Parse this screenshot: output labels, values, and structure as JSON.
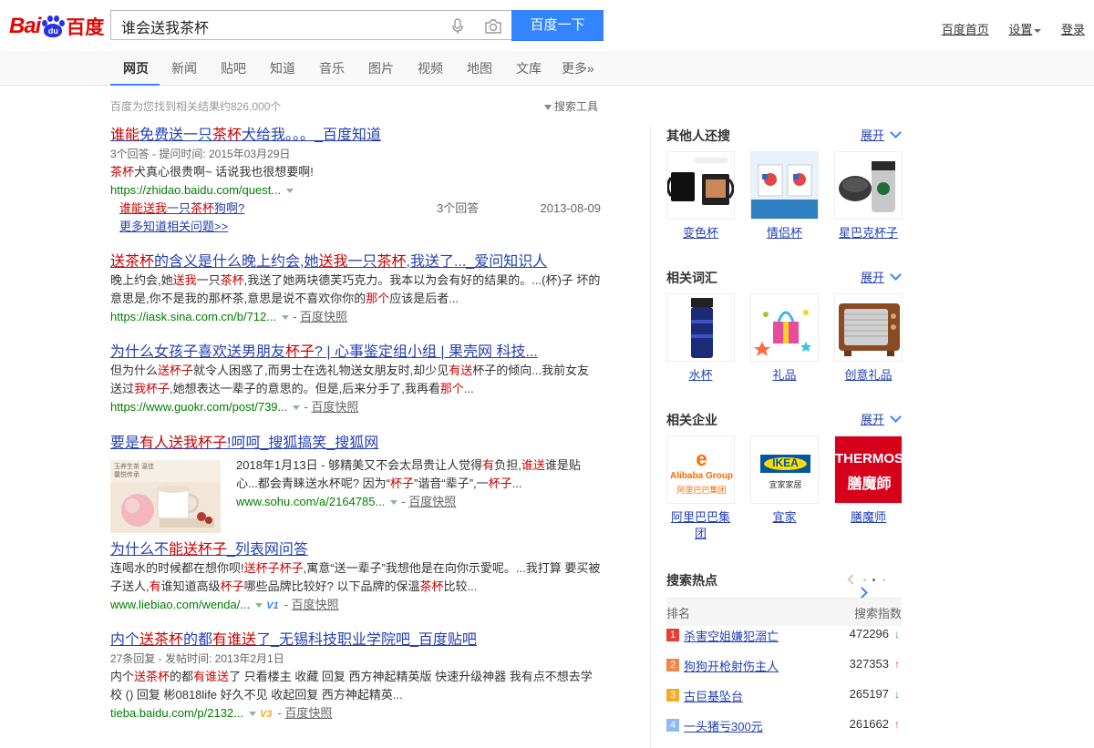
{
  "header": {
    "logo": {
      "bai": "Bai",
      "du": "du",
      "cn": "百度"
    },
    "search": {
      "value": "谁会送我茶杯",
      "button": "百度一下"
    },
    "links": {
      "home": "百度首页",
      "settings": "设置",
      "login": "登录"
    }
  },
  "nav": {
    "tabs": [
      "网页",
      "新闻",
      "贴吧",
      "知道",
      "音乐",
      "图片",
      "视频",
      "地图",
      "文库",
      "更多»"
    ],
    "active": "网页"
  },
  "stats": {
    "count": "百度为您找到相关结果约826,000个",
    "tools": "搜索工具"
  },
  "results": [
    {
      "title_parts": [
        {
          "t": "谁能",
          "h": true
        },
        {
          "t": "免费送一只",
          "h": false
        },
        {
          "t": "茶杯",
          "h": true
        },
        {
          "t": "犬给我。。。_百度知道",
          "h": false
        }
      ],
      "meta": "3个回答 - 提问时间: 2015年03月29日",
      "abstract_parts": [
        {
          "t": "茶杯",
          "h": true
        },
        {
          "t": "犬真心很贵啊~ 话说我也很想要啊!",
          "h": false
        }
      ],
      "url": "https://zhidao.baidu.com/quest...",
      "sub": {
        "q_parts": [
          {
            "t": "谁能送我",
            "h": true
          },
          {
            "t": "一只",
            "h": false
          },
          {
            "t": "茶杯",
            "h": true
          },
          {
            "t": "狗啊?",
            "h": false
          }
        ],
        "count": "3个回答",
        "date": "2013-08-09"
      },
      "more": "更多知道相关问题>>"
    },
    {
      "title_parts": [
        {
          "t": "送茶杯",
          "h": true
        },
        {
          "t": "的含义是什么晚上约会,她",
          "h": false
        },
        {
          "t": "送我",
          "h": true
        },
        {
          "t": "一只",
          "h": false
        },
        {
          "t": "茶杯",
          "h": true
        },
        {
          "t": ",我送了..._爱问知识人",
          "h": false
        }
      ],
      "abstract_lines": [
        [
          {
            "t": "晚上约会,她",
            "h": false
          },
          {
            "t": "送我",
            "h": true
          },
          {
            "t": "一只",
            "h": false
          },
          {
            "t": "茶杯",
            "h": true
          },
          {
            "t": ",我送了她两块德芙巧克力。我本以为会有好的结果的。...(杯)子 坏的",
            "h": false
          }
        ],
        [
          {
            "t": "意思是,你不是我的那杯茶,意思是说不喜欢你你的",
            "h": false
          },
          {
            "t": "那个",
            "h": true
          },
          {
            "t": "应该是后者...",
            "h": false
          }
        ]
      ],
      "url": "https://iask.sina.com.cn/b/712...",
      "snapshot": "百度快照"
    },
    {
      "title_parts": [
        {
          "t": "为什么女孩子喜欢送男朋友",
          "h": false
        },
        {
          "t": "杯子",
          "h": true
        },
        {
          "t": "? | 心事鉴定组小组 | 果壳网 科技...",
          "h": false
        }
      ],
      "abstract_lines": [
        [
          {
            "t": "但为什么",
            "h": false
          },
          {
            "t": "送杯子",
            "h": true
          },
          {
            "t": "就令人困惑了,而男士在选礼物送女朋友时,却少见",
            "h": false
          },
          {
            "t": "有送",
            "h": true
          },
          {
            "t": "杯子的倾向...我前女友",
            "h": false
          }
        ],
        [
          {
            "t": "送过",
            "h": false
          },
          {
            "t": "我杯子",
            "h": true
          },
          {
            "t": ",她想表达一辈子的意思的。但是,后来分手了,我再看",
            "h": false
          },
          {
            "t": "那个",
            "h": true
          },
          {
            "t": "...",
            "h": false
          }
        ]
      ],
      "url": "https://www.guokr.com/post/739...",
      "snapshot": "百度快照"
    },
    {
      "title_parts": [
        {
          "t": "要是",
          "h": false
        },
        {
          "t": "有人送我杯子",
          "h": true
        },
        {
          "t": "!呵呵_搜狐搞笑_搜狐网",
          "h": false
        }
      ],
      "abstract_lines": [
        [
          {
            "t": "2018年1月13日 - 够精美又不会太昂贵让人觉得",
            "h": false
          },
          {
            "t": "有",
            "h": true
          },
          {
            "t": "负担,",
            "h": false
          },
          {
            "t": "谁送",
            "h": true
          },
          {
            "t": "谁是贴",
            "h": false
          }
        ],
        [
          {
            "t": "心...都会青睐送水杯呢? 因为“",
            "h": false
          },
          {
            "t": "杯子",
            "h": true
          },
          {
            "t": "”谐音“辈子”,一",
            "h": false
          },
          {
            "t": "杯子",
            "h": true
          },
          {
            "t": "...",
            "h": false
          }
        ]
      ],
      "thumb_text": "玉养生茶 温佳 馨悦传承",
      "url": "www.sohu.com/a/2164785...",
      "snapshot": "百度快照"
    },
    {
      "title_parts": [
        {
          "t": "为什么不",
          "h": false
        },
        {
          "t": "能送杯子",
          "h": true
        },
        {
          "t": "_列表网问答",
          "h": false
        }
      ],
      "abstract_lines": [
        [
          {
            "t": "连喝水的时候都在想你呗!",
            "h": false
          },
          {
            "t": "送杯子杯子",
            "h": true
          },
          {
            "t": ",寓意“送一辈子”我想他是在向你示愛呢。...我打算 要买被",
            "h": false
          }
        ],
        [
          {
            "t": "子送人,",
            "h": false
          },
          {
            "t": "有",
            "h": true
          },
          {
            "t": "谁知道高级",
            "h": false
          },
          {
            "t": "杯子",
            "h": true
          },
          {
            "t": "哪些品牌比较好? 以下品牌的保温",
            "h": false
          },
          {
            "t": "茶杯",
            "h": true
          },
          {
            "t": "比较...",
            "h": false
          }
        ]
      ],
      "url": "www.liebiao.com/wenda/...",
      "vbadge": "V1",
      "snapshot": "百度快照"
    },
    {
      "title_parts": [
        {
          "t": "内个",
          "h": false
        },
        {
          "t": "送茶杯",
          "h": true
        },
        {
          "t": "的都",
          "h": false
        },
        {
          "t": "有谁送",
          "h": true
        },
        {
          "t": "了_无锡科技职业学院吧_百度贴吧",
          "h": false
        }
      ],
      "meta": "27条回复 - 发帖时间: 2013年2月1日",
      "abstract_lines": [
        [
          {
            "t": "内个",
            "h": false
          },
          {
            "t": "送茶杯",
            "h": true
          },
          {
            "t": "的都",
            "h": false
          },
          {
            "t": "有谁送",
            "h": true
          },
          {
            "t": "了 只看楼主 收藏 回复 西方神起精英版 快速升级神器 我有点不想去学",
            "h": false
          }
        ],
        [
          {
            "t": "校 () 回复 彬0818life 好久不见 收起回复 西方神起精英...",
            "h": false
          }
        ]
      ],
      "url": "tieba.baidu.com/p/2132...",
      "vbadge": "V3",
      "snapshot": "百度快照"
    }
  ],
  "sidebar": {
    "others": {
      "title": "其他人还搜",
      "expand": "展开",
      "items": [
        {
          "label": "变色杯"
        },
        {
          "label": "情侣杯"
        },
        {
          "label": "星巴克杯子"
        }
      ]
    },
    "related": {
      "title": "相关词汇",
      "expand": "展开",
      "items": [
        {
          "label": "水杯"
        },
        {
          "label": "礼品"
        },
        {
          "label": "创意礼品"
        }
      ]
    },
    "companies": {
      "title": "相关企业",
      "expand": "展开",
      "items": [
        {
          "label": "阿里巴巴集团",
          "logo_text": "Alibaba Group",
          "logo_cn": "阿里巴巴集团"
        },
        {
          "label": "宜家",
          "logo_text": "IKEA",
          "logo_cn": "宜家家居"
        },
        {
          "label": "膳魔师",
          "logo_text": "THERMOS",
          "logo_cn": "膳魔師"
        }
      ]
    },
    "hot": {
      "title": "搜索热点",
      "col_rank": "排名",
      "col_index": "搜索指数",
      "rows": [
        {
          "rank": "1",
          "query": "杀害空姐嫌犯溺亡",
          "value": "472296",
          "trend": "down",
          "color": "#e33e33"
        },
        {
          "rank": "2",
          "query": "狗狗开枪射伤主人",
          "value": "327353",
          "trend": "up",
          "color": "#f1844b"
        },
        {
          "rank": "3",
          "query": "古巨基坠台",
          "value": "265197",
          "trend": "down",
          "color": "#f3ad24"
        },
        {
          "rank": "4",
          "query": "一头猪亏300元",
          "value": "261662",
          "trend": "up",
          "color": "#8eb9f5"
        }
      ]
    }
  },
  "colors": {
    "accent": "#3385ff",
    "link": "#2440b3",
    "highlight": "#cc0000",
    "url": "#008000"
  }
}
